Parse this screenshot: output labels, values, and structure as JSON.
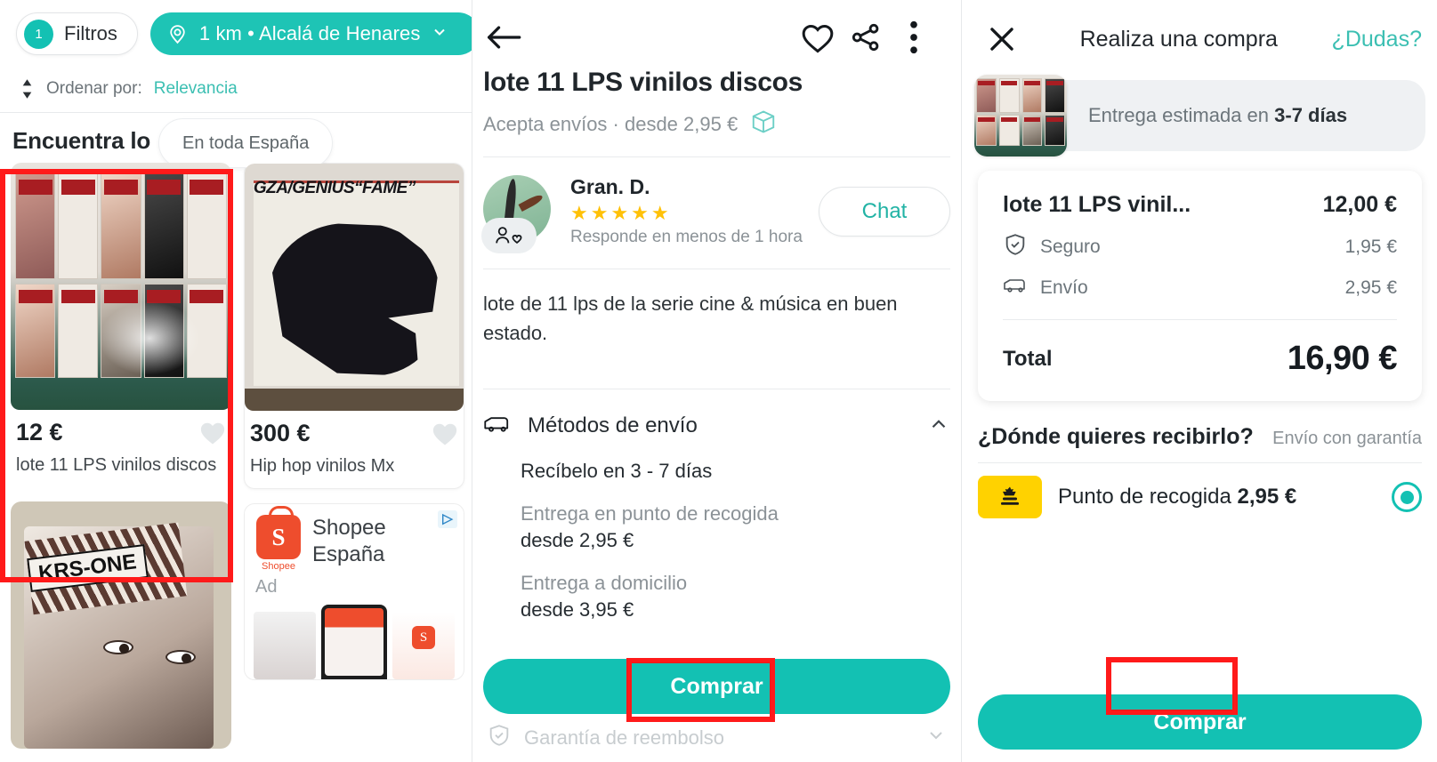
{
  "left_panel": {
    "filters": {
      "count": "1",
      "label": "Filtros"
    },
    "location_pill": {
      "label": "1 km • Alcalá de Henares",
      "icon": "location-pin-icon"
    },
    "sort": {
      "prefix": "Ordenar por:",
      "value": "Relevancia"
    },
    "section_title": "Encuentra lo",
    "scope_pill": "En toda España",
    "listings": [
      {
        "price": "12 €",
        "title": "lote 11 LPS vinilos discos",
        "art": "cine",
        "selected": true
      },
      {
        "price": "300 €",
        "title": "Hip hop vinilos Mx",
        "art": "gza",
        "cover_text": "GZA/GENIUS“FAME”",
        "selected": false
      },
      {
        "price": "",
        "title": "",
        "art": "krs",
        "cover_text": "KRS-ONE",
        "selected": false
      }
    ],
    "ad": {
      "brand": "Shopee",
      "title_line1": "Shopee",
      "title_line2": "España",
      "logo_letter": "S",
      "tag": "Ad",
      "adchoices": "▷"
    }
  },
  "middle_panel": {
    "icons": {
      "back": "back-arrow-icon",
      "favorite": "heart-icon",
      "share": "share-icon",
      "more": "more-vertical-icon"
    },
    "title": "lote 11 LPS vinilos discos",
    "subtitle": "Acepta envíos · desde 2,95 €",
    "seller": {
      "name": "Gran. D.",
      "stars": "★★★★★",
      "response": "Responde en menos de 1 hora",
      "chat_label": "Chat"
    },
    "description": "lote de 11 lps de la serie cine & música en buen estado.",
    "shipping": {
      "header": "Métodos de envío",
      "chevron": "chevron-up-icon",
      "receive_line": "Recíbelo en 3 - 7 días",
      "options": [
        {
          "name": "Entrega en punto de recogida",
          "price": "desde 2,95 €"
        },
        {
          "name": "Entrega a domicilio",
          "price": "desde 3,95 €"
        }
      ]
    },
    "buy_label": "Comprar",
    "refund_row": "Garantía de reembolso"
  },
  "right_panel": {
    "close": "close-icon",
    "title": "Realiza una compra",
    "help_label": "¿Dudas?",
    "eta": {
      "prefix": "Entrega estimada en ",
      "days": "3-7 días"
    },
    "summary": {
      "item_name": "lote 11 LPS vinil...",
      "item_price": "12,00 €",
      "lines": [
        {
          "icon": "shield-check-icon",
          "label": "Seguro",
          "value": "1,95 €"
        },
        {
          "icon": "van-icon",
          "label": "Envío",
          "value": "2,95 €"
        }
      ],
      "total_label": "Total",
      "total_value": "16,90 €"
    },
    "where": {
      "title": "¿Dónde quieres recibirlo?",
      "subtitle": "Envío con garantía",
      "option_label": "Punto de recogida ",
      "option_price": "2,95 €",
      "carrier_icon": "correos-crown-icon"
    },
    "buy_label": "Comprar"
  },
  "colors": {
    "teal": "#13C1B3",
    "teal_pill": "#1EC4B5",
    "annotation_red": "#FF1A1A",
    "star_gold": "#FFC107",
    "correos_yellow": "#FFD200"
  }
}
